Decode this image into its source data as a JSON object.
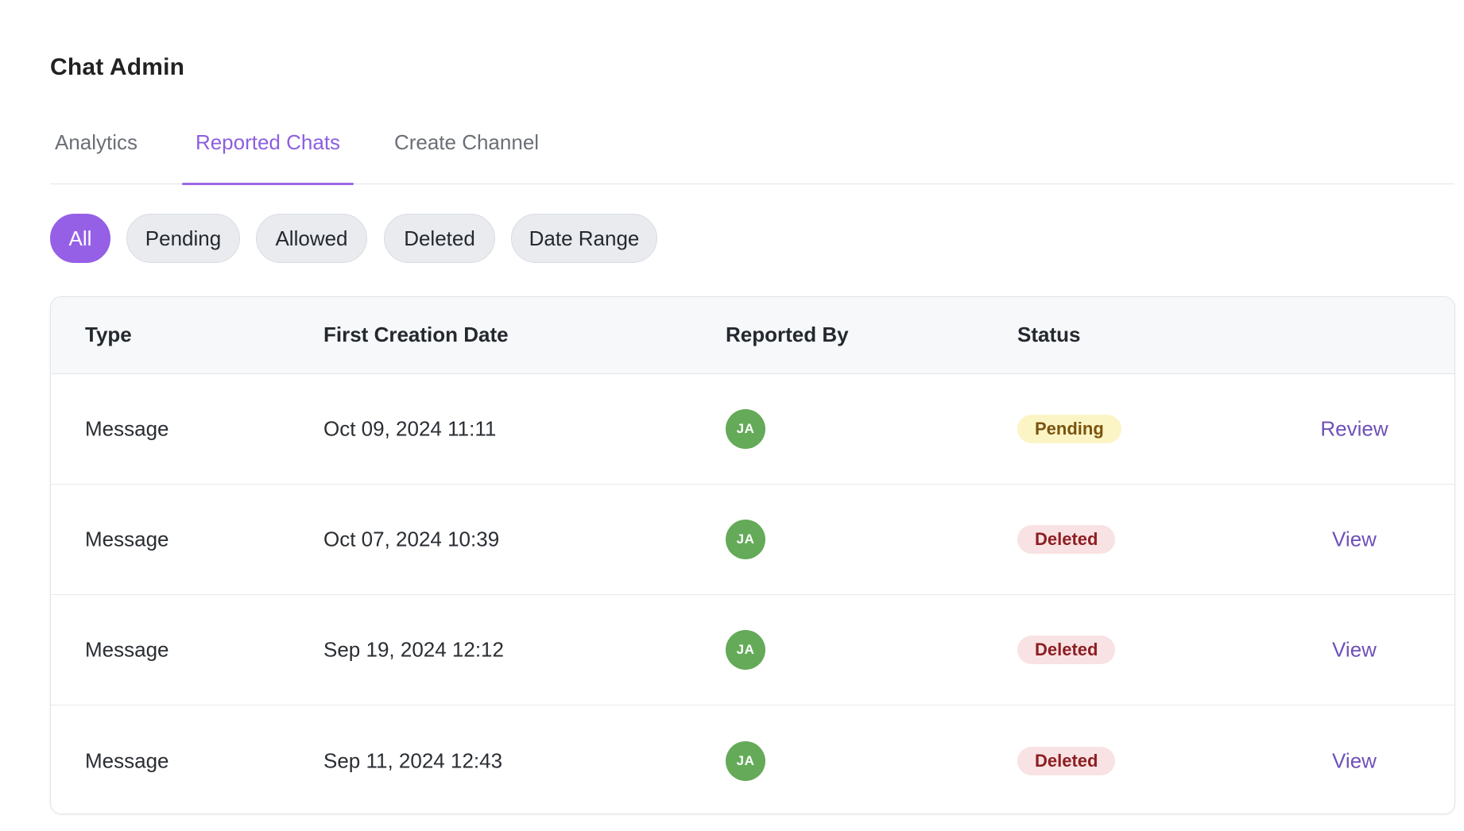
{
  "header": {
    "title": "Chat Admin"
  },
  "tabs": [
    {
      "label": "Analytics",
      "active": false
    },
    {
      "label": "Reported Chats",
      "active": true
    },
    {
      "label": "Create Channel",
      "active": false
    }
  ],
  "filters": [
    {
      "label": "All",
      "active": true
    },
    {
      "label": "Pending",
      "active": false
    },
    {
      "label": "Allowed",
      "active": false
    },
    {
      "label": "Deleted",
      "active": false
    },
    {
      "label": "Date Range",
      "active": false
    }
  ],
  "table": {
    "columns": [
      "Type",
      "First Creation Date",
      "Reported By",
      "Status"
    ],
    "rows": [
      {
        "type": "Message",
        "date": "Oct 09, 2024 11:11",
        "reporter_initials": "JA",
        "status": "Pending",
        "action": "Review"
      },
      {
        "type": "Message",
        "date": "Oct 07, 2024 10:39",
        "reporter_initials": "JA",
        "status": "Deleted",
        "action": "View"
      },
      {
        "type": "Message",
        "date": "Sep 19, 2024 12:12",
        "reporter_initials": "JA",
        "status": "Deleted",
        "action": "View"
      },
      {
        "type": "Message",
        "date": "Sep 11, 2024 12:43",
        "reporter_initials": "JA",
        "status": "Deleted",
        "action": "View"
      }
    ]
  },
  "colors": {
    "accent": "#9560e6",
    "avatar": "#64aa58",
    "pending_bg": "#fbf5c6",
    "deleted_bg": "#f9e2e3"
  }
}
